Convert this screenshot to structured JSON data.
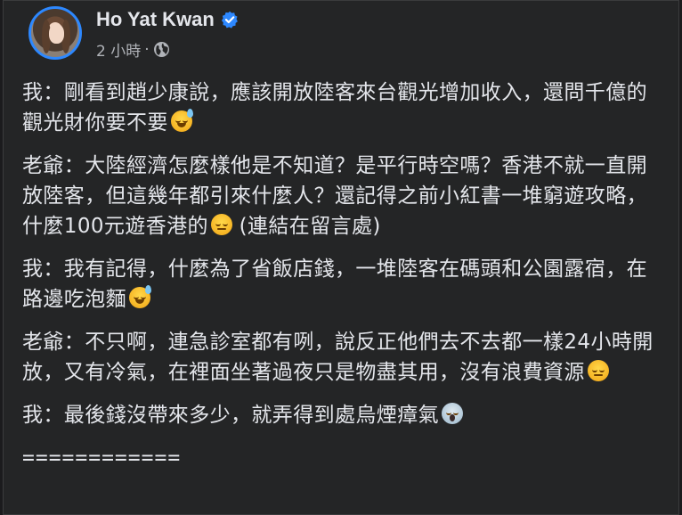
{
  "post": {
    "author": "Ho Yat Kwan",
    "timestamp": "2 小時",
    "separator": "·",
    "privacy_icon": "globe-icon",
    "verified_icon": "verified-badge-icon",
    "accent_color": "#2d88ff"
  },
  "paragraphs": [
    {
      "text": "我：剛看到趙少康說，應該開放陸客來台觀光增加收入，還問千億的觀光財你要不要",
      "emoji": "grinning-sweat-emoji"
    },
    {
      "text": "老爺：大陸經濟怎麼樣他是不知道？是平行時空嗎？香港不就一直開放陸客，但這幾年都引來什麼人？還記得之前小紅書一堆窮遊攻略，什麼100元遊香港的",
      "emoji": "relieved-emoji",
      "suffix": " (連結在留言處)"
    },
    {
      "text": "我：我有記得，什麼為了省飯店錢，一堆陸客在碼頭和公園露宿，在路邊吃泡麵",
      "emoji": "grinning-sweat-emoji"
    },
    {
      "text": "老爺：不只啊，連急診室都有咧，說反正他們去不去都一樣24小時開放，又有冷氣，在裡面坐著過夜只是物盡其用，沒有浪費資源",
      "emoji": "relieved-emoji"
    },
    {
      "text": "我：最後錢沒帶來多少，就弄得到處烏煙瘴氣",
      "emoji": "face-screaming-emoji"
    }
  ],
  "divider": "============"
}
